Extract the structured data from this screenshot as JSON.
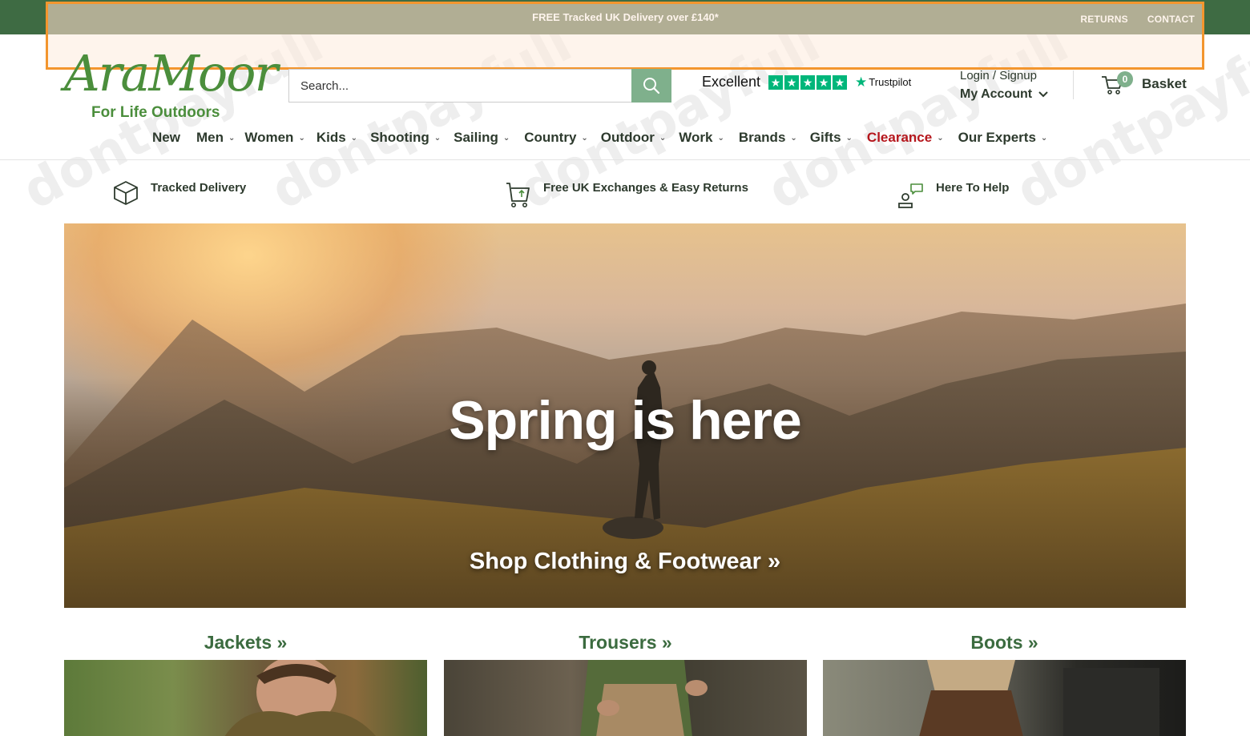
{
  "topbar": {
    "promo": "FREE Tracked UK Delivery over £140*",
    "returns": "RETURNS",
    "contact": "CONTACT"
  },
  "logo": {
    "wordmark": "AraMoor",
    "tagline": "For Life Outdoors"
  },
  "search": {
    "placeholder": "Search..."
  },
  "trustpilot": {
    "rating_text": "Excellent",
    "stars": 5,
    "brand": "Trustpilot"
  },
  "account": {
    "login": "Login / Signup",
    "my_account": "My Account"
  },
  "basket": {
    "count": "0",
    "label": "Basket"
  },
  "nav": {
    "items": [
      {
        "label": "New"
      },
      {
        "label": "Men"
      },
      {
        "label": "Women"
      },
      {
        "label": "Kids"
      },
      {
        "label": "Shooting"
      },
      {
        "label": "Sailing"
      },
      {
        "label": "Country"
      },
      {
        "label": "Outdoor"
      },
      {
        "label": "Work"
      },
      {
        "label": "Brands"
      },
      {
        "label": "Gifts"
      },
      {
        "label": "Clearance"
      },
      {
        "label": "Our Experts"
      }
    ]
  },
  "usps": [
    {
      "label": "Tracked Delivery",
      "icon": "box-icon"
    },
    {
      "label": "Free UK Exchanges & Easy Returns",
      "icon": "cart-return-icon"
    },
    {
      "label": "Here To Help",
      "icon": "support-chat-icon"
    }
  ],
  "hero": {
    "title": "Spring is here",
    "cta": "Shop Clothing & Footwear »"
  },
  "categories": [
    {
      "label": "Jackets »"
    },
    {
      "label": "Trousers »"
    },
    {
      "label": "Boots »"
    }
  ],
  "colors": {
    "topbar": "#55643c",
    "brand_green": "#4b8e3c",
    "search_button": "#7fb08c",
    "trustpilot": "#00b67a",
    "clearance": "#b5161c",
    "highlight": "#f3962e"
  },
  "watermark": "dontpayfull"
}
